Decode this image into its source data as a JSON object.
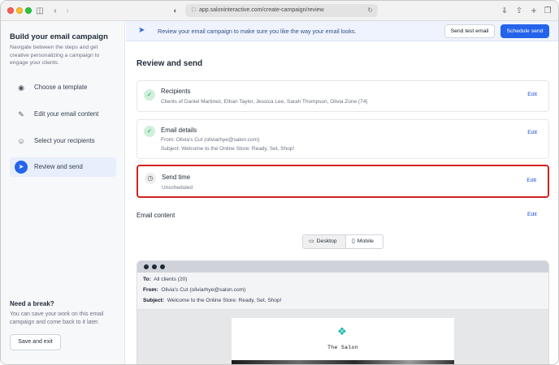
{
  "browser": {
    "url": "app.saloninteractive.com/create-campaign/review",
    "icons": [
      "sidebar-toggle-icon",
      "back-icon",
      "forward-icon",
      "shield-icon",
      "lock-icon",
      "reload-icon",
      "download-icon",
      "share-icon",
      "new-tab-icon",
      "tabs-icon"
    ]
  },
  "sidebar": {
    "title": "Build your email campaign",
    "description": "Navigate between the steps and get creative personalizing a campaign to engage your clients.",
    "steps": [
      {
        "label": "Choose a template",
        "icon": "palette-icon",
        "active": false
      },
      {
        "label": "Edit your email content",
        "icon": "pencil-icon",
        "active": false
      },
      {
        "label": "Select your recipients",
        "icon": "users-icon",
        "active": false
      },
      {
        "label": "Review and send",
        "icon": "paper-plane-icon",
        "active": true
      }
    ],
    "break_title": "Need a break?",
    "break_desc": "You can save your work on this email campaign and come back to it later.",
    "save_exit_label": "Save and exit"
  },
  "banner": {
    "text": "Review your email campaign to make sure you like the way your email looks.",
    "send_test_label": "Send test email",
    "schedule_label": "Schedule send"
  },
  "main": {
    "title": "Review and send",
    "cards": [
      {
        "title": "Recipients",
        "subtitle": "Clients of Daniel Martinez, Ethan Taylor, Jessica Lee, Sarah Thompson, Olivia Zone (74)",
        "status": "complete",
        "edit_label": "Edit"
      },
      {
        "title": "Email details",
        "from": "From: Olivia's Cut (oliviarhye@salon.com)",
        "subject": "Subject: Welcome to the Online Store: Ready, Set, Shop!",
        "status": "complete",
        "edit_label": "Edit"
      },
      {
        "title": "Send time",
        "subtitle": "Unscheduled",
        "status": "pending",
        "edit_label": "Edit"
      }
    ],
    "email_content_label": "Email content",
    "email_content_edit": "Edit",
    "view_options": [
      {
        "label": "Desktop",
        "icon": "monitor-icon",
        "selected": true
      },
      {
        "label": "Mobile",
        "icon": "phone-icon",
        "selected": false
      }
    ]
  },
  "preview": {
    "to_label": "To:",
    "to_value": "All clients (20)",
    "from_label": "From:",
    "from_value": "Olivia's Cut (oliviarhye@salon.com)",
    "subject_label": "Subject:",
    "subject_value": "Welcome to the Online Store: Ready, Set, Shop!",
    "salon_name": "The Salon"
  },
  "colors": {
    "accent": "#2563eb",
    "success": "#16a34a",
    "highlight_border": "#d32222"
  }
}
